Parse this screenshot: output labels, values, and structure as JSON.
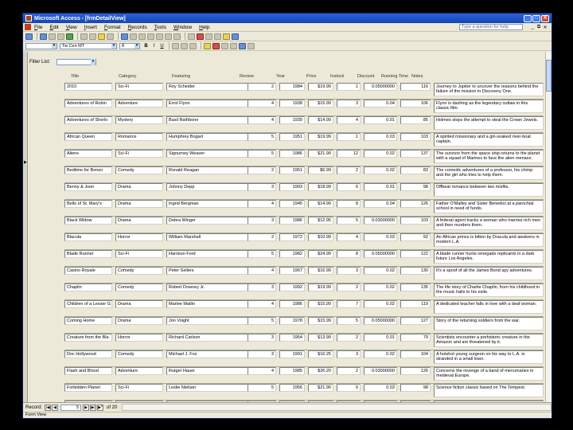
{
  "window": {
    "title": "Microsoft Access - [frmDetailView]"
  },
  "menu": [
    "File",
    "Edit",
    "View",
    "Insert",
    "Format",
    "Records",
    "Tools",
    "Window",
    "Help"
  ],
  "help_placeholder": "Type a question for help",
  "formatting": {
    "font": "Tw Cen MT",
    "size": "8",
    "bold": "B",
    "italic": "I",
    "underline": "U"
  },
  "filter": {
    "label": "Filter List:"
  },
  "headers": {
    "title": "Title",
    "category": "Category",
    "featuring": "Featuring",
    "review": "Review",
    "year": "Year",
    "price": "Price",
    "instock": "Instock",
    "discount": "Discount",
    "running_time": "Running Time",
    "notes": "Notes"
  },
  "records": [
    {
      "title": "2010",
      "category": "Sci-Fi",
      "featuring": "Roy Scheider",
      "review": "2",
      "year": "1984",
      "price": "$19.99",
      "instock": "1",
      "discount": "0.05000000",
      "runtime": "116",
      "notes": "Journey to Jupiter to uncover the reasons behind the failure of the mission in Discovery One."
    },
    {
      "title": "Adventures of Robin",
      "category": "Adventure",
      "featuring": "Errol Flynn",
      "review": "4",
      "year": "1938",
      "price": "$15.99",
      "instock": "3",
      "discount": "0.04",
      "runtime": "106",
      "notes": "Flynn is dashing as the legendary outlaw in this classic film."
    },
    {
      "title": "Adventures of Sherlo",
      "category": "Mystery",
      "featuring": "Basil Rathbone",
      "review": "4",
      "year": "1939",
      "price": "$14.99",
      "instock": "4",
      "discount": "0.01",
      "runtime": "85",
      "notes": "Holmes stops the attempt to steal the Crown Jewels."
    },
    {
      "title": "African Queen",
      "category": "Romance",
      "featuring": "Humphrey Bogart",
      "review": "5",
      "year": "1951",
      "price": "$19.99",
      "instock": "1",
      "discount": "0.03",
      "runtime": "103",
      "notes": "A spirited missionary and a gin-soaked river-boat captain."
    },
    {
      "title": "Aliens",
      "category": "Sci-Fi",
      "featuring": "Sigourney Weaver",
      "review": "5",
      "year": "1986",
      "price": "$21.99",
      "instock": "12",
      "discount": "0.02",
      "runtime": "137",
      "notes": "The survivor from the space ship returns to the planet with a squad of Marines to face the alien menace."
    },
    {
      "title": "Bedtime for Bonzo",
      "category": "Comedy",
      "featuring": "Ronald Reagan",
      "review": "2",
      "year": "1951",
      "price": "$6.99",
      "instock": "2",
      "discount": "0.02",
      "runtime": "83",
      "notes": "The comedic adventures of a professor, his chimp and the girl who tries to help them."
    },
    {
      "title": "Benny & Joon",
      "category": "Drama",
      "featuring": "Johnny Depp",
      "review": "3",
      "year": "1993",
      "price": "$18.99",
      "instock": "6",
      "discount": "0.01",
      "runtime": "98",
      "notes": "Offbeat romance between two misfits."
    },
    {
      "title": "Bells of St. Mary's",
      "category": "Drama",
      "featuring": "Ingrid Bergman",
      "review": "4",
      "year": "1945",
      "price": "$14.99",
      "instock": "8",
      "discount": "0.04",
      "runtime": "126",
      "notes": "Father O'Malley and Sister Benedict at a parochial school in need of funds."
    },
    {
      "title": "Black Widow",
      "category": "Drama",
      "featuring": "Debra Winger",
      "review": "3",
      "year": "1986",
      "price": "$12.95",
      "instock": "5",
      "discount": "0.03000000",
      "runtime": "103",
      "notes": "A federal agent tracks a woman who marries rich men and then murders them."
    },
    {
      "title": "Blacula",
      "category": "Horror",
      "featuring": "William Marshall",
      "review": "2",
      "year": "1972",
      "price": "$10.99",
      "instock": "4",
      "discount": "0.03",
      "runtime": "92",
      "notes": "An African prince is bitten by Dracula and awakens in modern L.A."
    },
    {
      "title": "Blade Runner",
      "category": "Sci-Fi",
      "featuring": "Harrison Ford",
      "review": "5",
      "year": "1982",
      "price": "$24.99",
      "instock": "8",
      "discount": "0.05000000",
      "runtime": "122",
      "notes": "A blade runner hunts renegade replicants in a dark future Los Angeles."
    },
    {
      "title": "Casino Royale",
      "category": "Comedy",
      "featuring": "Peter Sellers",
      "review": "4",
      "year": "1967",
      "price": "$16.99",
      "instock": "3",
      "discount": "0.02",
      "runtime": "130",
      "notes": "It's a spoof of all the James Bond spy adventures."
    },
    {
      "title": "Chaplin",
      "category": "Comedy",
      "featuring": "Robert Downey Jr.",
      "review": "3",
      "year": "1992",
      "price": "$19.99",
      "instock": "2",
      "discount": "0.02",
      "runtime": "135",
      "notes": "The life story of Charlie Chaplin, from his childhood in the music halls to his exile."
    },
    {
      "title": "Children of a Lesser G",
      "category": "Drama",
      "featuring": "Marlee Matlin",
      "review": "4",
      "year": "1986",
      "price": "$15.99",
      "instock": "7",
      "discount": "0.02",
      "runtime": "119",
      "notes": "A dedicated teacher falls in love with a deaf woman."
    },
    {
      "title": "Coming Home",
      "category": "Drama",
      "featuring": "Jon Voight",
      "review": "5",
      "year": "1978",
      "price": "$15.99",
      "instock": "5",
      "discount": "0.05000000",
      "runtime": "127",
      "notes": "Story of the returning soldiers from the war."
    },
    {
      "title": "Creature from the Bla",
      "category": "Horror",
      "featuring": "Richard Carlson",
      "review": "3",
      "year": "1954",
      "price": "$13.99",
      "instock": "2",
      "discount": "0.01",
      "runtime": "79",
      "notes": "Scientists encounter a prehistoric creature in the Amazon and are threatened by it."
    },
    {
      "title": "Doc Hollywood",
      "category": "Comedy",
      "featuring": "Michael J. Fox",
      "review": "3",
      "year": "1991",
      "price": "$16.25",
      "instock": "3",
      "discount": "0.02",
      "runtime": "104",
      "notes": "A hotshot young surgeon on his way to L.A. is stranded in a small town."
    },
    {
      "title": "Flash and Blood",
      "category": "Adventure",
      "featuring": "Rutger Hauer",
      "review": "4",
      "year": "1985",
      "price": "$26.20",
      "instock": "2",
      "discount": "0.03000000",
      "runtime": "126",
      "notes": "Concerns the revenge of a band of mercenaries in medieval Europe."
    },
    {
      "title": "Forbidden Planet",
      "category": "Sci-Fi",
      "featuring": "Leslie Nielsen",
      "review": "5",
      "year": "1956",
      "price": "$21.90",
      "instock": "6",
      "discount": "0.03",
      "runtime": "98",
      "notes": "Science fiction classic based on The Tempest."
    },
    {
      "title": "Front Page, The",
      "category": "Comedy",
      "featuring": "Walter Matthau",
      "review": "3",
      "year": "1974",
      "price": "$11.99",
      "instock": "3",
      "discount": "0.03",
      "runtime": "105",
      "notes": "Chicago reporter in the 1920s trying to get an exclusive story."
    }
  ],
  "navigation": {
    "label": "Record:",
    "current": "5",
    "of_text": "of 20"
  },
  "status": {
    "text": "Form View"
  }
}
